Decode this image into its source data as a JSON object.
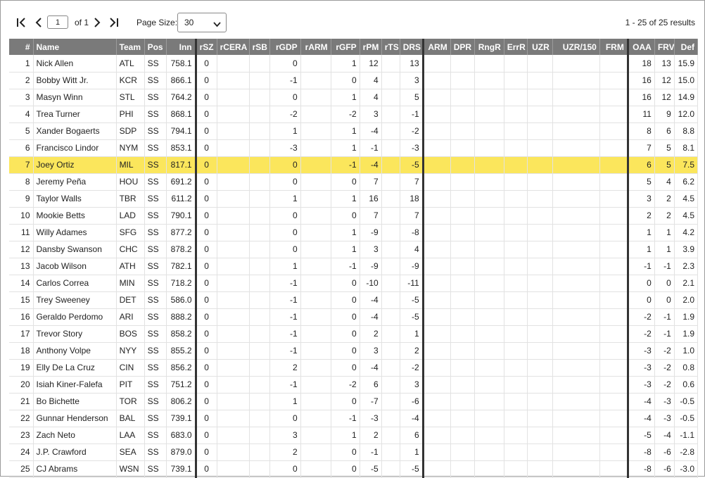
{
  "pager": {
    "current_page": "1",
    "of_label": "of 1",
    "page_size_label": "Page Size:",
    "page_size": "30",
    "results": "1 - 25 of 25 results"
  },
  "colors": {
    "header_bg": "#7a7a7a",
    "highlight": "#fbe65c",
    "separator": "#333333"
  },
  "icons": [
    "first-page-icon",
    "prev-page-icon",
    "next-page-icon",
    "last-page-icon",
    "chevron-down-icon"
  ],
  "columns": [
    "#",
    "Name",
    "Team",
    "Pos",
    "Inn",
    "rSZ",
    "rCERA",
    "rSB",
    "rGDP",
    "rARM",
    "rGFP",
    "rPM",
    "rTS",
    "DRS",
    "ARM",
    "DPR",
    "RngR",
    "ErrR",
    "UZR",
    "UZR/150",
    "FRM",
    "OAA",
    "FRV",
    "Def"
  ],
  "highlighted_row": 7,
  "rows": [
    {
      "n": "1",
      "name": "Nick Allen",
      "team": "ATL",
      "pos": "SS",
      "inn": "758.1",
      "rsz": "0",
      "rgdp": "0",
      "rgfp": "1",
      "rpm": "12",
      "drs": "13",
      "oaa": "18",
      "frv": "13",
      "def": "15.9"
    },
    {
      "n": "2",
      "name": "Bobby Witt Jr.",
      "team": "KCR",
      "pos": "SS",
      "inn": "866.1",
      "rsz": "0",
      "rgdp": "-1",
      "rgfp": "0",
      "rpm": "4",
      "drs": "3",
      "oaa": "16",
      "frv": "12",
      "def": "15.0"
    },
    {
      "n": "3",
      "name": "Masyn Winn",
      "team": "STL",
      "pos": "SS",
      "inn": "764.2",
      "rsz": "0",
      "rgdp": "0",
      "rgfp": "1",
      "rpm": "4",
      "drs": "5",
      "oaa": "16",
      "frv": "12",
      "def": "14.9"
    },
    {
      "n": "4",
      "name": "Trea Turner",
      "team": "PHI",
      "pos": "SS",
      "inn": "868.1",
      "rsz": "0",
      "rgdp": "-2",
      "rgfp": "-2",
      "rpm": "3",
      "drs": "-1",
      "oaa": "11",
      "frv": "9",
      "def": "12.0"
    },
    {
      "n": "5",
      "name": "Xander Bogaerts",
      "team": "SDP",
      "pos": "SS",
      "inn": "794.1",
      "rsz": "0",
      "rgdp": "1",
      "rgfp": "1",
      "rpm": "-4",
      "drs": "-2",
      "oaa": "8",
      "frv": "6",
      "def": "8.8"
    },
    {
      "n": "6",
      "name": "Francisco Lindor",
      "team": "NYM",
      "pos": "SS",
      "inn": "853.1",
      "rsz": "0",
      "rgdp": "-3",
      "rgfp": "1",
      "rpm": "-1",
      "drs": "-3",
      "oaa": "7",
      "frv": "5",
      "def": "8.1"
    },
    {
      "n": "7",
      "name": "Joey Ortiz",
      "team": "MIL",
      "pos": "SS",
      "inn": "817.1",
      "rsz": "0",
      "rgdp": "0",
      "rgfp": "-1",
      "rpm": "-4",
      "drs": "-5",
      "oaa": "6",
      "frv": "5",
      "def": "7.5"
    },
    {
      "n": "8",
      "name": "Jeremy Peña",
      "team": "HOU",
      "pos": "SS",
      "inn": "691.2",
      "rsz": "0",
      "rgdp": "0",
      "rgfp": "0",
      "rpm": "7",
      "drs": "7",
      "oaa": "5",
      "frv": "4",
      "def": "6.2"
    },
    {
      "n": "9",
      "name": "Taylor Walls",
      "team": "TBR",
      "pos": "SS",
      "inn": "611.2",
      "rsz": "0",
      "rgdp": "1",
      "rgfp": "1",
      "rpm": "16",
      "drs": "18",
      "oaa": "3",
      "frv": "2",
      "def": "4.5"
    },
    {
      "n": "10",
      "name": "Mookie Betts",
      "team": "LAD",
      "pos": "SS",
      "inn": "790.1",
      "rsz": "0",
      "rgdp": "0",
      "rgfp": "0",
      "rpm": "7",
      "drs": "7",
      "oaa": "2",
      "frv": "2",
      "def": "4.5"
    },
    {
      "n": "11",
      "name": "Willy Adames",
      "team": "SFG",
      "pos": "SS",
      "inn": "877.2",
      "rsz": "0",
      "rgdp": "0",
      "rgfp": "1",
      "rpm": "-9",
      "drs": "-8",
      "oaa": "1",
      "frv": "1",
      "def": "4.2"
    },
    {
      "n": "12",
      "name": "Dansby Swanson",
      "team": "CHC",
      "pos": "SS",
      "inn": "878.2",
      "rsz": "0",
      "rgdp": "0",
      "rgfp": "1",
      "rpm": "3",
      "drs": "4",
      "oaa": "1",
      "frv": "1",
      "def": "3.9"
    },
    {
      "n": "13",
      "name": "Jacob Wilson",
      "team": "ATH",
      "pos": "SS",
      "inn": "782.1",
      "rsz": "0",
      "rgdp": "1",
      "rgfp": "-1",
      "rpm": "-9",
      "drs": "-9",
      "oaa": "-1",
      "frv": "-1",
      "def": "2.3"
    },
    {
      "n": "14",
      "name": "Carlos Correa",
      "team": "MIN",
      "pos": "SS",
      "inn": "718.2",
      "rsz": "0",
      "rgdp": "-1",
      "rgfp": "0",
      "rpm": "-10",
      "drs": "-11",
      "oaa": "0",
      "frv": "0",
      "def": "2.1"
    },
    {
      "n": "15",
      "name": "Trey Sweeney",
      "team": "DET",
      "pos": "SS",
      "inn": "586.0",
      "rsz": "0",
      "rgdp": "-1",
      "rgfp": "0",
      "rpm": "-4",
      "drs": "-5",
      "oaa": "0",
      "frv": "0",
      "def": "2.0"
    },
    {
      "n": "16",
      "name": "Geraldo Perdomo",
      "team": "ARI",
      "pos": "SS",
      "inn": "888.2",
      "rsz": "0",
      "rgdp": "-1",
      "rgfp": "0",
      "rpm": "-4",
      "drs": "-5",
      "oaa": "-2",
      "frv": "-1",
      "def": "1.9"
    },
    {
      "n": "17",
      "name": "Trevor Story",
      "team": "BOS",
      "pos": "SS",
      "inn": "858.2",
      "rsz": "0",
      "rgdp": "-1",
      "rgfp": "0",
      "rpm": "2",
      "drs": "1",
      "oaa": "-2",
      "frv": "-1",
      "def": "1.9"
    },
    {
      "n": "18",
      "name": "Anthony Volpe",
      "team": "NYY",
      "pos": "SS",
      "inn": "855.2",
      "rsz": "0",
      "rgdp": "-1",
      "rgfp": "0",
      "rpm": "3",
      "drs": "2",
      "oaa": "-3",
      "frv": "-2",
      "def": "1.0"
    },
    {
      "n": "19",
      "name": "Elly De La Cruz",
      "team": "CIN",
      "pos": "SS",
      "inn": "856.2",
      "rsz": "0",
      "rgdp": "2",
      "rgfp": "0",
      "rpm": "-4",
      "drs": "-2",
      "oaa": "-3",
      "frv": "-2",
      "def": "0.8"
    },
    {
      "n": "20",
      "name": "Isiah Kiner-Falefa",
      "team": "PIT",
      "pos": "SS",
      "inn": "751.2",
      "rsz": "0",
      "rgdp": "-1",
      "rgfp": "-2",
      "rpm": "6",
      "drs": "3",
      "oaa": "-3",
      "frv": "-2",
      "def": "0.6"
    },
    {
      "n": "21",
      "name": "Bo Bichette",
      "team": "TOR",
      "pos": "SS",
      "inn": "806.2",
      "rsz": "0",
      "rgdp": "1",
      "rgfp": "0",
      "rpm": "-7",
      "drs": "-6",
      "oaa": "-4",
      "frv": "-3",
      "def": "-0.5"
    },
    {
      "n": "22",
      "name": "Gunnar Henderson",
      "team": "BAL",
      "pos": "SS",
      "inn": "739.1",
      "rsz": "0",
      "rgdp": "0",
      "rgfp": "-1",
      "rpm": "-3",
      "drs": "-4",
      "oaa": "-4",
      "frv": "-3",
      "def": "-0.5"
    },
    {
      "n": "23",
      "name": "Zach Neto",
      "team": "LAA",
      "pos": "SS",
      "inn": "683.0",
      "rsz": "0",
      "rgdp": "3",
      "rgfp": "1",
      "rpm": "2",
      "drs": "6",
      "oaa": "-5",
      "frv": "-4",
      "def": "-1.1"
    },
    {
      "n": "24",
      "name": "J.P. Crawford",
      "team": "SEA",
      "pos": "SS",
      "inn": "879.0",
      "rsz": "0",
      "rgdp": "2",
      "rgfp": "0",
      "rpm": "-1",
      "drs": "1",
      "oaa": "-8",
      "frv": "-6",
      "def": "-2.8"
    },
    {
      "n": "25",
      "name": "CJ Abrams",
      "team": "WSN",
      "pos": "SS",
      "inn": "739.1",
      "rsz": "0",
      "rgdp": "0",
      "rgfp": "0",
      "rpm": "-5",
      "drs": "-5",
      "oaa": "-8",
      "frv": "-6",
      "def": "-3.0"
    }
  ]
}
